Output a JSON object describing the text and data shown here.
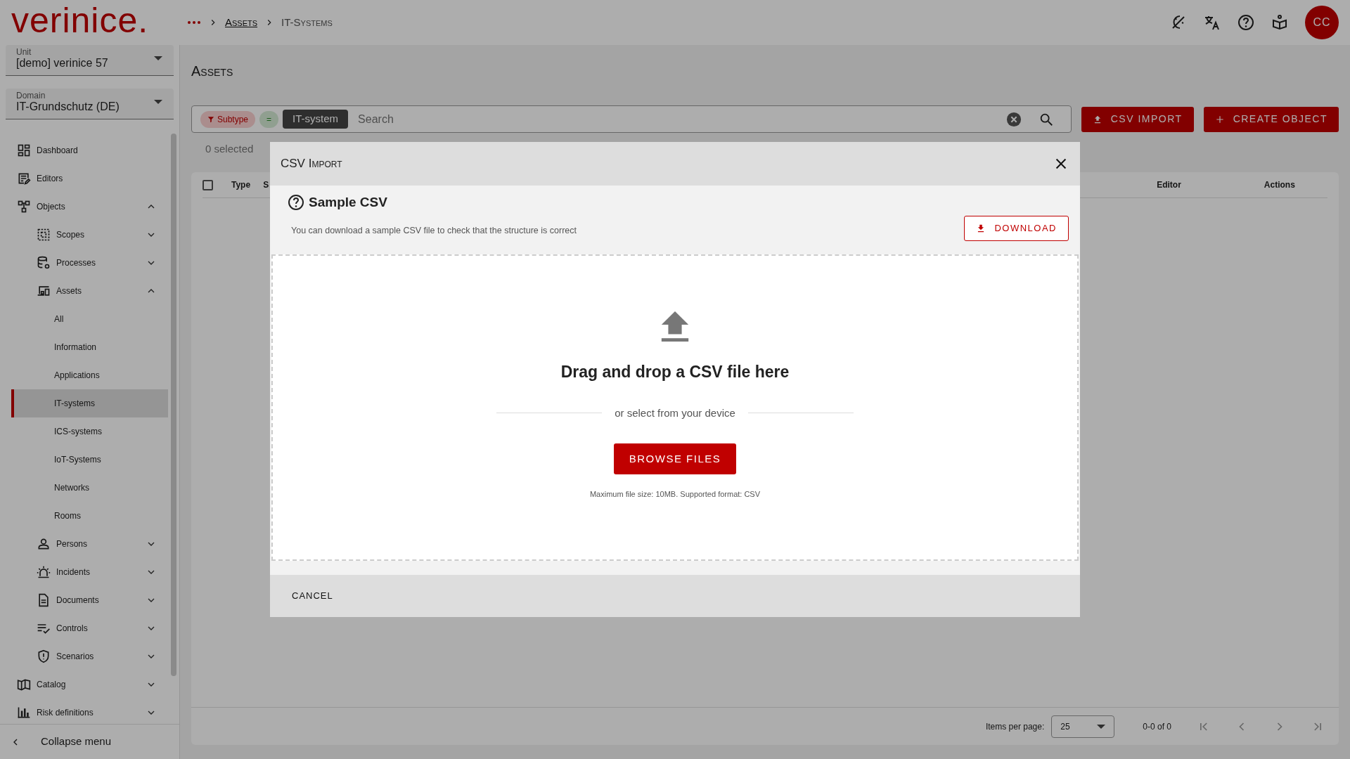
{
  "header": {
    "logo": "verinice.",
    "breadcrumb": [
      {
        "label": "Assets",
        "kind": "link"
      },
      {
        "label": "IT-Systems",
        "kind": "current"
      }
    ],
    "avatar": "CC"
  },
  "sidebar": {
    "selects": [
      {
        "label": "Unit",
        "value": "[demo] verinice 57"
      },
      {
        "label": "Domain",
        "value": "IT-Grundschutz (DE)"
      }
    ],
    "items": [
      {
        "label": "Dashboard",
        "selected": false
      },
      {
        "label": "Editors",
        "selected": false
      },
      {
        "label": "Objects",
        "selected": false,
        "expanded": true,
        "children": [
          {
            "label": "Scopes",
            "selected": false,
            "expanded": false
          },
          {
            "label": "Processes",
            "selected": false,
            "expanded": false
          },
          {
            "label": "Assets",
            "selected": false,
            "expanded": true,
            "children": [
              {
                "label": "All",
                "selected": false
              },
              {
                "label": "Information",
                "selected": false
              },
              {
                "label": "Applications",
                "selected": false
              },
              {
                "label": "IT-systems",
                "selected": true
              },
              {
                "label": "ICS-systems",
                "selected": false
              },
              {
                "label": "IoT-Systems",
                "selected": false
              },
              {
                "label": "Networks",
                "selected": false
              },
              {
                "label": "Rooms",
                "selected": false
              }
            ]
          },
          {
            "label": "Persons",
            "selected": false,
            "expanded": false
          },
          {
            "label": "Incidents",
            "selected": false,
            "expanded": false
          },
          {
            "label": "Documents",
            "selected": false,
            "expanded": false
          },
          {
            "label": "Controls",
            "selected": false,
            "expanded": false
          },
          {
            "label": "Scenarios",
            "selected": false,
            "expanded": false
          }
        ]
      },
      {
        "label": "Catalog",
        "selected": false,
        "expanded": false
      },
      {
        "label": "Risk definitions",
        "selected": false,
        "expanded": false
      }
    ],
    "collapse": "Collapse menu"
  },
  "main": {
    "title": "Assets",
    "filter": {
      "chips": [
        {
          "kind": "field",
          "text": "Subtype"
        },
        {
          "kind": "operator",
          "text": "="
        },
        {
          "kind": "value",
          "text": "IT-system"
        }
      ],
      "placeholder": "Search"
    },
    "buttons": [
      {
        "label": "CSV IMPORT",
        "kind": "import"
      },
      {
        "label": "CREATE OBJECT",
        "kind": "create"
      }
    ],
    "selection": "0 selected",
    "select_all": {
      "checked": false
    },
    "columns": [
      "Type",
      "S",
      "Editor",
      "Actions"
    ],
    "pagination": {
      "label": "Items per page:",
      "page_size": "25",
      "range": "0-0 of 0"
    }
  },
  "dialog": {
    "title": "CSV Import",
    "sample_title": "Sample CSV",
    "sample_text": "You can download a sample CSV file to check that the structure is correct",
    "download": "DOWNLOAD",
    "drop_title": "Drag and drop a CSV file here",
    "or_text": "or select from your device",
    "browse": "BROWSE FILES",
    "hint": "Maximum file size: 10MB. Supported format: CSV",
    "cancel": "CANCEL"
  }
}
